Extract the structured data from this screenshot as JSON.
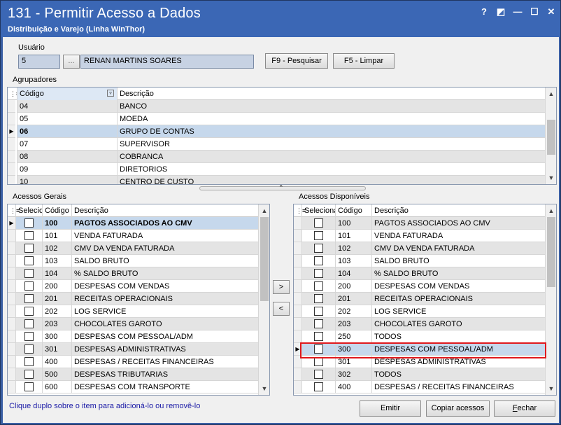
{
  "window": {
    "title": "131 - Permitir Acesso a Dados",
    "subtitle": "Distribuição e Varejo (Linha WinThor)",
    "help_glyph": "?",
    "restore_glyph": "◩",
    "minimize_glyph": "—",
    "maximize_glyph": "☐",
    "close_glyph": "✕"
  },
  "usuario": {
    "label": "Usuário",
    "code": "5",
    "lookup_label": "...",
    "name": "RENAN MARTINS SOARES",
    "search_button": "F9 - Pesquisar",
    "clear_button": "F5 - Limpar"
  },
  "agrupadores": {
    "label": "Agrupadores",
    "columns": [
      "Código",
      "Descrição"
    ],
    "rows": [
      {
        "code": "04",
        "desc": "BANCO"
      },
      {
        "code": "05",
        "desc": "MOEDA"
      },
      {
        "code": "06",
        "desc": "GRUPO DE CONTAS",
        "selected": true
      },
      {
        "code": "07",
        "desc": "SUPERVISOR"
      },
      {
        "code": "08",
        "desc": "COBRANCA"
      },
      {
        "code": "09",
        "desc": "DIRETORIOS"
      },
      {
        "code": "10",
        "desc": "CENTRO DE CUSTO"
      }
    ]
  },
  "acessos_gerais": {
    "label": "Acessos Gerais",
    "columns": [
      "Selecio",
      "Código",
      "Descrição"
    ],
    "rows": [
      {
        "code": "100",
        "desc": "PAGTOS ASSOCIADOS AO CMV",
        "selected": true
      },
      {
        "code": "101",
        "desc": "VENDA FATURADA"
      },
      {
        "code": "102",
        "desc": "CMV DA VENDA FATURADA"
      },
      {
        "code": "103",
        "desc": "SALDO BRUTO"
      },
      {
        "code": "104",
        "desc": "% SALDO BRUTO"
      },
      {
        "code": "200",
        "desc": "DESPESAS COM VENDAS"
      },
      {
        "code": "201",
        "desc": "RECEITAS OPERACIONAIS"
      },
      {
        "code": "202",
        "desc": "LOG SERVICE"
      },
      {
        "code": "203",
        "desc": "CHOCOLATES GAROTO"
      },
      {
        "code": "300",
        "desc": "DESPESAS COM PESSOAL/ADM"
      },
      {
        "code": "301",
        "desc": "DESPESAS ADMINISTRATIVAS"
      },
      {
        "code": "400",
        "desc": "DESPESAS / RECEITAS FINANCEIRAS"
      },
      {
        "code": "500",
        "desc": "DESPESAS TRIBUTARIAS"
      },
      {
        "code": "600",
        "desc": "DESPESAS COM TRANSPORTE"
      }
    ]
  },
  "acessos_disponiveis": {
    "label": "Acessos Disponíveis",
    "columns": [
      "Seleciona",
      "Código",
      "Descrição"
    ],
    "rows": [
      {
        "code": "100",
        "desc": "PAGTOS ASSOCIADOS AO CMV"
      },
      {
        "code": "101",
        "desc": "VENDA FATURADA"
      },
      {
        "code": "102",
        "desc": "CMV DA VENDA FATURADA"
      },
      {
        "code": "103",
        "desc": "SALDO BRUTO"
      },
      {
        "code": "104",
        "desc": "% SALDO BRUTO"
      },
      {
        "code": "200",
        "desc": "DESPESAS COM VENDAS"
      },
      {
        "code": "201",
        "desc": "RECEITAS OPERACIONAIS"
      },
      {
        "code": "202",
        "desc": "LOG SERVICE"
      },
      {
        "code": "203",
        "desc": "CHOCOLATES GAROTO"
      },
      {
        "code": "250",
        "desc": "TODOS"
      },
      {
        "code": "300",
        "desc": "DESPESAS COM PESSOAL/ADM",
        "selected": true
      },
      {
        "code": "301",
        "desc": "DESPESAS ADMINISTRATIVAS"
      },
      {
        "code": "302",
        "desc": "TODOS"
      },
      {
        "code": "400",
        "desc": "DESPESAS / RECEITAS FINANCEIRAS"
      }
    ]
  },
  "transfer": {
    "add": ">",
    "remove": "<"
  },
  "hint": "Clique duplo sobre o item para adicioná-lo ou removê-lo",
  "footer": {
    "emitir": "Emitir",
    "copiar": "Copiar acessos",
    "fechar_prefix": "F",
    "fechar_rest": "echar"
  },
  "colors": {
    "titlebar": "#3b67b5",
    "highlight": "#e0191d",
    "hint": "#1a1aa6"
  }
}
